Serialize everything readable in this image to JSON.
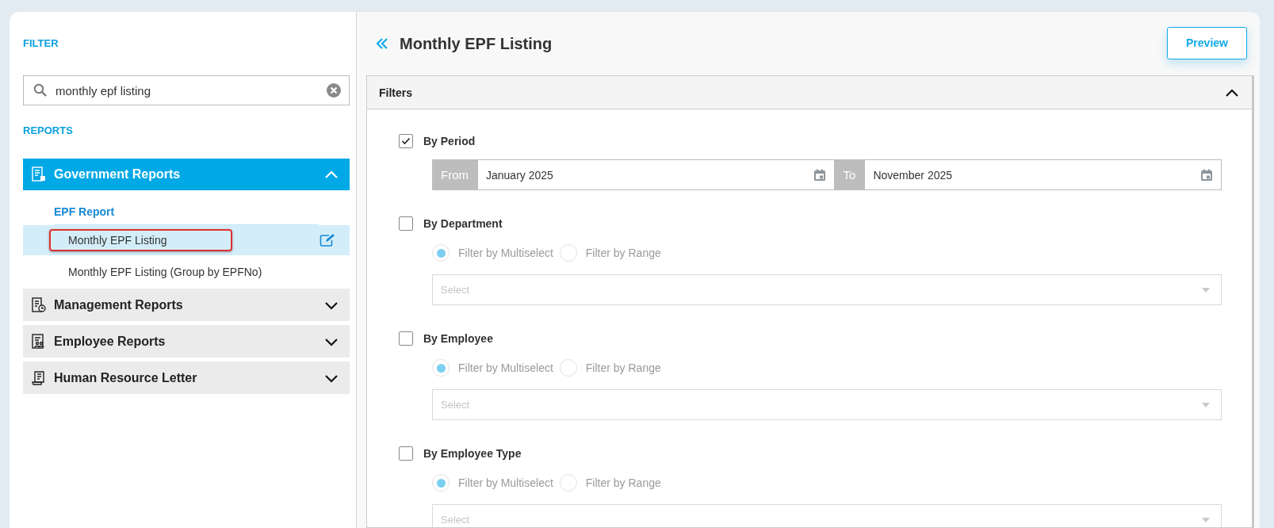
{
  "sidebar": {
    "filter_heading": "FILTER",
    "search": {
      "value": "monthly epf listing"
    },
    "reports_heading": "REPORTS",
    "groups": [
      {
        "title": "Government Reports",
        "expanded": true,
        "children": [
          {
            "title": "EPF Report",
            "items": [
              {
                "label": "Monthly EPF Listing",
                "selected": true,
                "marked": true
              },
              {
                "label": "Monthly EPF Listing (Group by EPFNo)",
                "selected": false,
                "marked": false
              }
            ]
          }
        ]
      },
      {
        "title": "Management Reports",
        "expanded": false
      },
      {
        "title": "Employee Reports",
        "expanded": false
      },
      {
        "title": "Human Resource Letter",
        "expanded": false
      }
    ]
  },
  "main": {
    "title": "Monthly EPF Listing",
    "preview_button": "Preview",
    "filters": {
      "title": "Filters",
      "expanded": true,
      "sections": [
        {
          "kind": "period",
          "label": "By Period",
          "checked": true,
          "from_label": "From",
          "from_value": "January 2025",
          "to_label": "To",
          "to_value": "November 2025"
        },
        {
          "kind": "choice",
          "label": "By Department",
          "checked": false,
          "disabled": true,
          "options": [
            {
              "label": "Filter by Multiselect",
              "selected": true
            },
            {
              "label": "Filter by Range",
              "selected": false
            }
          ],
          "placeholder": "Select"
        },
        {
          "kind": "choice",
          "label": "By Employee",
          "checked": false,
          "disabled": true,
          "options": [
            {
              "label": "Filter by Multiselect",
              "selected": true
            },
            {
              "label": "Filter by Range",
              "selected": false
            }
          ],
          "placeholder": "Select"
        },
        {
          "kind": "choice",
          "label": "By Employee Type",
          "checked": false,
          "disabled": true,
          "options": [
            {
              "label": "Filter by Multiselect",
              "selected": true
            },
            {
              "label": "Filter by Range",
              "selected": false
            }
          ],
          "placeholder": "Select"
        }
      ]
    }
  }
}
